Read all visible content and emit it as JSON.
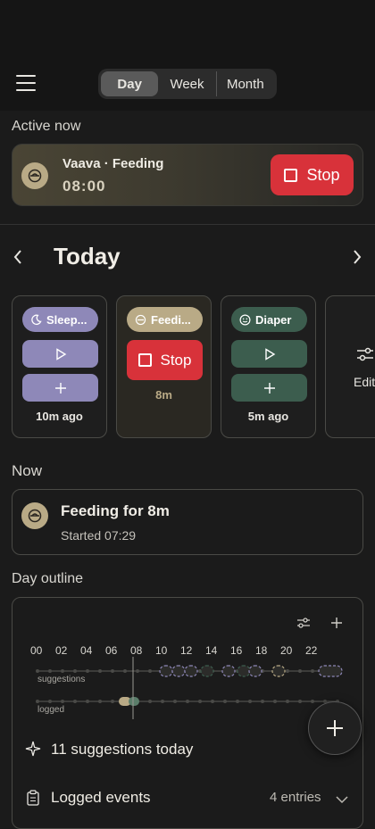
{
  "header": {
    "tabs": [
      {
        "label": "Day",
        "active": true
      },
      {
        "label": "Week",
        "active": false
      },
      {
        "label": "Month",
        "active": false
      }
    ]
  },
  "active_now": {
    "heading": "Active now",
    "title": "Vaava · Feeding",
    "elapsed": "08:00",
    "stop_label": "Stop"
  },
  "day_nav": {
    "title": "Today"
  },
  "tiles": [
    {
      "chip": "Sleep...",
      "footer": "10m ago",
      "color": "#8e88b8"
    },
    {
      "chip": "Feedi...",
      "stop_label": "Stop",
      "footer": "8m",
      "color": "#b9aa86"
    },
    {
      "chip": "Diaper",
      "footer": "5m ago",
      "color": "#3c5d4e"
    },
    {
      "label": "Edit"
    }
  ],
  "now": {
    "heading": "Now",
    "title": "Feeding for 8m",
    "subtitle": "Started 07:29"
  },
  "day_outline": {
    "heading": "Day outline",
    "hours": [
      "00",
      "02",
      "04",
      "06",
      "08",
      "10",
      "12",
      "14",
      "16",
      "18",
      "20",
      "22"
    ],
    "row_suggestions": "suggestions",
    "row_logged": "logged",
    "suggestions_text": "11 suggestions today",
    "logged_label": "Logged events",
    "logged_count": "4 entries"
  },
  "colors": {
    "stop_red": "#d8323a",
    "sleep_purple": "#8e88b8",
    "feeding_tan": "#b9aa86",
    "diaper_green": "#3c5d4e"
  }
}
